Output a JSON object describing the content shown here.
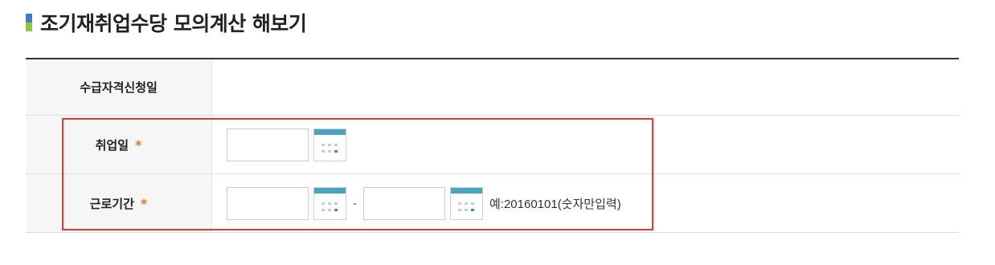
{
  "page": {
    "title": "조기재취업수당 모의계산 해보기",
    "accent_colors": {
      "title_bar_top": "#3f7fc1",
      "title_bar_bottom": "#8cc63f",
      "required_star": "#e87722",
      "highlight": "#e53935",
      "calendar_header": "#4aa3bf"
    }
  },
  "form": {
    "rows": [
      {
        "label": "수급자격신청일",
        "value": ""
      },
      {
        "label": "취업일",
        "required_mark": "*",
        "date_value": "",
        "calendar_icon": "calendar-icon"
      },
      {
        "label": "근로기간",
        "required_mark": "*",
        "start_value": "",
        "separator": "-",
        "end_value": "",
        "calendar_icon": "calendar-icon",
        "hint": "예:20160101(숫자만입력)"
      }
    ]
  }
}
